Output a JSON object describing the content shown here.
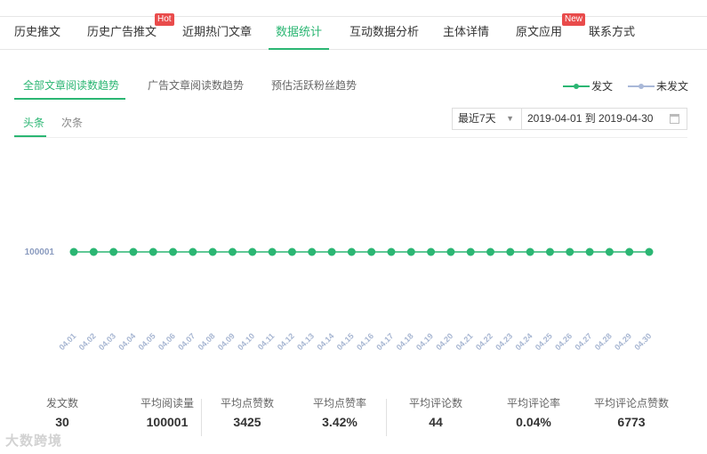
{
  "nav": {
    "items": [
      {
        "label": "历史推文"
      },
      {
        "label": "历史广告推文",
        "badge": "Hot"
      },
      {
        "label": "近期热门文章"
      },
      {
        "label": "数据统计",
        "active": true
      },
      {
        "label": "互动数据分析"
      },
      {
        "label": "主体详情"
      },
      {
        "label": "原文应用",
        "badge": "New"
      },
      {
        "label": "联系方式"
      }
    ]
  },
  "subtabs": [
    {
      "label": "全部文章阅读数趋势",
      "active": true
    },
    {
      "label": "广告文章阅读数趋势"
    },
    {
      "label": "预估活跃粉丝趋势"
    }
  ],
  "legend": [
    {
      "label": "发文",
      "color": "#2bb673"
    },
    {
      "label": "未发文",
      "color": "#a9b8d8"
    }
  ],
  "channels": [
    {
      "label": "头条",
      "active": true
    },
    {
      "label": "次条"
    }
  ],
  "filters": {
    "range": "最近7天",
    "date_range": "2019-04-01 到 2019-04-30"
  },
  "chart_data": {
    "type": "line",
    "x": [
      "04.01",
      "04.02",
      "04.03",
      "04.04",
      "04.05",
      "04.06",
      "04.07",
      "04.08",
      "04.09",
      "04.10",
      "04.11",
      "04.12",
      "04.13",
      "04.14",
      "04.15",
      "04.16",
      "04.17",
      "04.18",
      "04.19",
      "04.20",
      "04.21",
      "04.22",
      "04.23",
      "04.24",
      "04.25",
      "04.26",
      "04.27",
      "04.28",
      "04.29",
      "04.30"
    ],
    "series": [
      {
        "name": "发文",
        "color": "#2bb673",
        "values": [
          100001,
          100001,
          100001,
          100001,
          100001,
          100001,
          100001,
          100001,
          100001,
          100001,
          100001,
          100001,
          100001,
          100001,
          100001,
          100001,
          100001,
          100001,
          100001,
          100001,
          100001,
          100001,
          100001,
          100001,
          100001,
          100001,
          100001,
          100001,
          100001,
          100001
        ]
      }
    ],
    "y_tick": "100001",
    "grid": false
  },
  "stats": [
    {
      "label": "发文数",
      "value": "30"
    },
    {
      "label": "平均阅读量",
      "value": "100001"
    },
    {
      "label": "平均点赞数",
      "value": "3425"
    },
    {
      "label": "平均点赞率",
      "value": "3.42%"
    },
    {
      "label": "平均评论数",
      "value": "44"
    },
    {
      "label": "平均评论率",
      "value": "0.04%"
    },
    {
      "label": "平均评论点赞数",
      "value": "6773"
    }
  ],
  "watermark": "大数跨境"
}
